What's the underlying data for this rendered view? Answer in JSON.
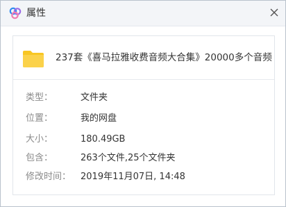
{
  "window": {
    "title": "属性",
    "icons": {
      "app": "baidu-netdisk-logo-icon",
      "close": "close-icon",
      "item": "folder-icon"
    }
  },
  "item": {
    "name": "237套《喜马拉雅收费音频大合集》20000多个音频"
  },
  "properties": [
    {
      "label": "类型：",
      "value": "文件夹"
    },
    {
      "label": "位置：",
      "value": "我的网盘"
    },
    {
      "label": "大小：",
      "value": "180.49GB"
    },
    {
      "label": "包含：",
      "value": "263个文件,25个文件夹"
    },
    {
      "label": "修改时间：",
      "value": "2019年11月07日, 14:48"
    }
  ],
  "colors": {
    "folder": "#f8c623",
    "logo_blue": "#2f8cf0",
    "logo_purple": "#9b6ce6",
    "logo_pink": "#f07cb0"
  }
}
